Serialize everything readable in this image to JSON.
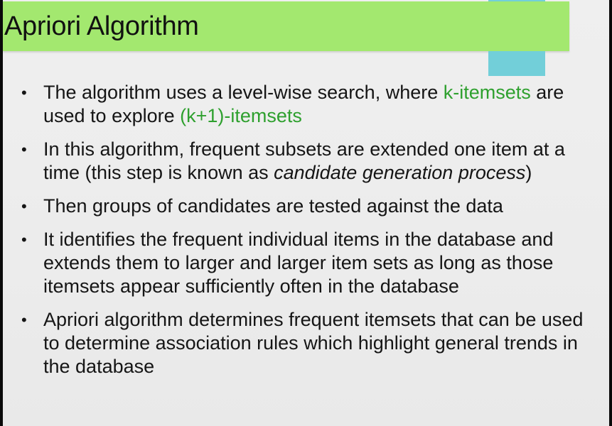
{
  "slide": {
    "title": "Apriori Algorithm",
    "bullet_symbol": "•",
    "colors": {
      "title_bar": "#a3e86f",
      "accent_block": "#72cfd9",
      "highlight_text": "#2ea02e"
    },
    "bullets": [
      {
        "part1": "The algorithm uses a level-wise search, where ",
        "green1": "k-itemsets",
        "part2": " are used to explore ",
        "green2": "(k+1)-itemsets"
      },
      {
        "part1": "In this algorithm, frequent subsets are extended one item at a time (this step is known as ",
        "italic": "candidate generation process",
        "part2": ")"
      },
      {
        "text": "Then groups of candidates are tested against the data"
      },
      {
        "text": "It identifies the frequent individual items in the database and extends them to larger and larger item sets as long as those itemsets appear sufficiently often in the database"
      },
      {
        "text": "Apriori algorithm determines frequent itemsets that can be used to determine association rules which highlight general trends in the database"
      }
    ]
  }
}
